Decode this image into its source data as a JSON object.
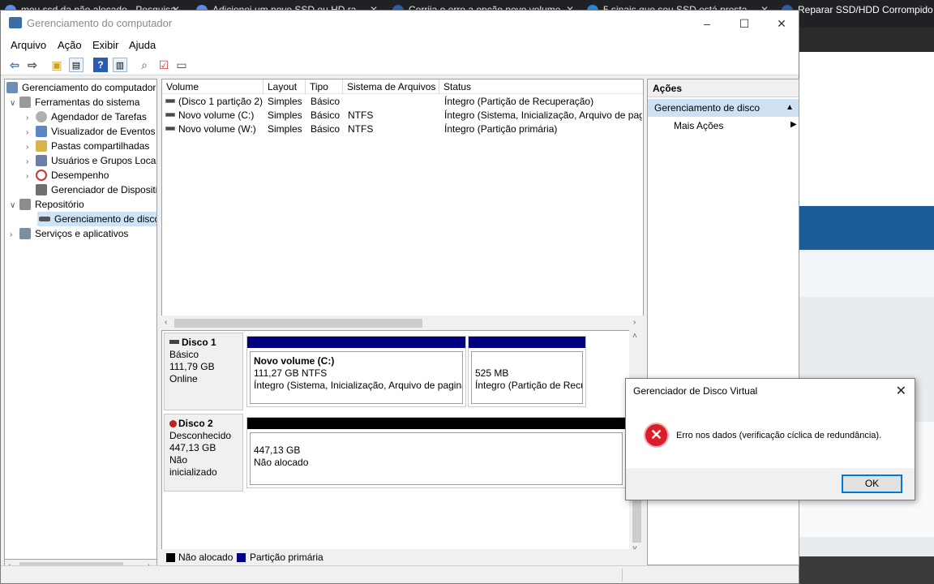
{
  "browser": {
    "tabs": [
      {
        "title": "meu ssd da não alocado - Pesquisa"
      },
      {
        "title": "Adicionei um novo SSD ou HD ra"
      },
      {
        "title": "Corrija o erro a opção novo volume"
      },
      {
        "title": "5 sinais que seu SSD está presta"
      },
      {
        "title": "Reparar SSD/HDD Corrompido"
      }
    ]
  },
  "window": {
    "title": "Gerenciamento do computador",
    "minimize_glyph": "–",
    "maximize_glyph": "☐",
    "close_glyph": "✕"
  },
  "menu": [
    "Arquivo",
    "Ação",
    "Exibir",
    "Ajuda"
  ],
  "tree": {
    "root": "Gerenciamento do computador (Local)",
    "items": [
      {
        "label": "Ferramentas do sistema",
        "icon": "tools-icon"
      },
      {
        "label": "Agendador de Tarefas",
        "icon": "clock-icon"
      },
      {
        "label": "Visualizador de Eventos",
        "icon": "event-viewer-icon"
      },
      {
        "label": "Pastas compartilhadas",
        "icon": "shared-folder-icon"
      },
      {
        "label": "Usuários e Grupos Locais",
        "icon": "users-icon"
      },
      {
        "label": "Desempenho",
        "icon": "performance-icon"
      },
      {
        "label": "Gerenciador de Dispositivos",
        "icon": "device-manager-icon"
      },
      {
        "label": "Repositório",
        "icon": "storage-icon"
      },
      {
        "label": "Gerenciamento de disco",
        "icon": "disk-icon"
      },
      {
        "label": "Serviços e aplicativos",
        "icon": "services-icon"
      }
    ]
  },
  "volumes": {
    "columns": [
      "Volume",
      "Layout",
      "Tipo",
      "Sistema de Arquivos",
      "Status"
    ],
    "rows": [
      [
        "(Disco 1 partição 2)",
        "Simples",
        "Básico",
        "",
        "Íntegro (Partição de Recuperação)"
      ],
      [
        "Novo volume (C:)",
        "Simples",
        "Básico",
        "NTFS",
        "Íntegro (Sistema, Inicialização, Arquivo de paginação"
      ],
      [
        "Novo volume (W:)",
        "Simples",
        "Básico",
        "NTFS",
        "Íntegro (Partição primária)"
      ]
    ]
  },
  "disks": [
    {
      "name": "Disco 1",
      "type": "Básico",
      "size": "111,79 GB",
      "state": "Online",
      "partitions": [
        {
          "title": "Novo volume  (C:)",
          "size": "111,27 GB NTFS",
          "status": "Íntegro (Sistema, Inicialização, Arquivo de paginação"
        },
        {
          "title": "",
          "size": "525 MB",
          "status": "Íntegro (Partição de Recuperação)"
        }
      ]
    },
    {
      "name": "Disco 2",
      "type": "Desconhecido",
      "size": "447,13 GB",
      "state": "Não inicializado",
      "partitions": [
        {
          "size": "447,13 GB",
          "status": "Não alocado"
        }
      ]
    }
  ],
  "legend": [
    {
      "label": "Não alocado",
      "color": "#000000"
    },
    {
      "label": "Partição primária",
      "color": "#000080"
    }
  ],
  "actions": {
    "header": "Ações",
    "section": "Gerenciamento de disco",
    "more": "Mais Ações"
  },
  "dialog": {
    "title": "Gerenciador de Disco Virtual",
    "message": "Erro nos dados (verificação cíclica de redundância).",
    "ok": "OK"
  },
  "colors": {
    "primary_partition": "#000080",
    "unallocated": "#000000",
    "selection": "#cce4f7",
    "error": "#d91e2a"
  }
}
